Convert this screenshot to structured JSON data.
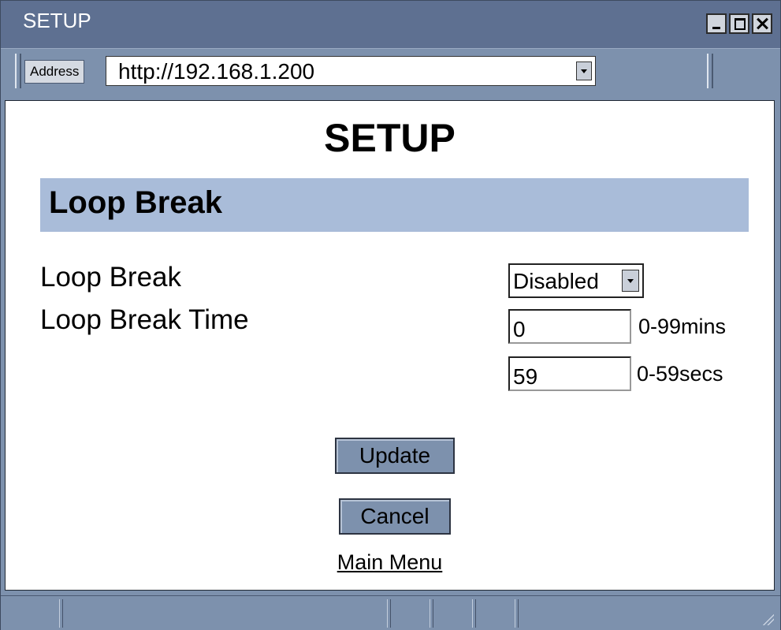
{
  "window": {
    "title": "SETUP"
  },
  "address": {
    "label": "Address",
    "url": "http://192.168.1.200"
  },
  "page": {
    "title": "SETUP",
    "section_title": "Loop Break"
  },
  "form": {
    "loop_break_label": "Loop Break",
    "loop_break_time_label": "Loop Break Time",
    "loop_break_select": {
      "value": "Disabled",
      "options": [
        "Disabled"
      ]
    },
    "minutes_value": "0",
    "minutes_unit": "0-99mins",
    "seconds_value": "59",
    "seconds_unit": "0-59secs",
    "update_label": "Update",
    "cancel_label": "Cancel",
    "main_menu_label": "Main Menu"
  },
  "colors": {
    "chrome": "#7d91ad",
    "titlebar": "#5e7091",
    "section_bar": "#a9bcd9"
  },
  "icons": {
    "minimize": "minimize-icon",
    "maximize": "maximize-icon",
    "close": "close-icon",
    "dropdown": "chevron-down-icon",
    "resize": "resize-grip-icon"
  }
}
